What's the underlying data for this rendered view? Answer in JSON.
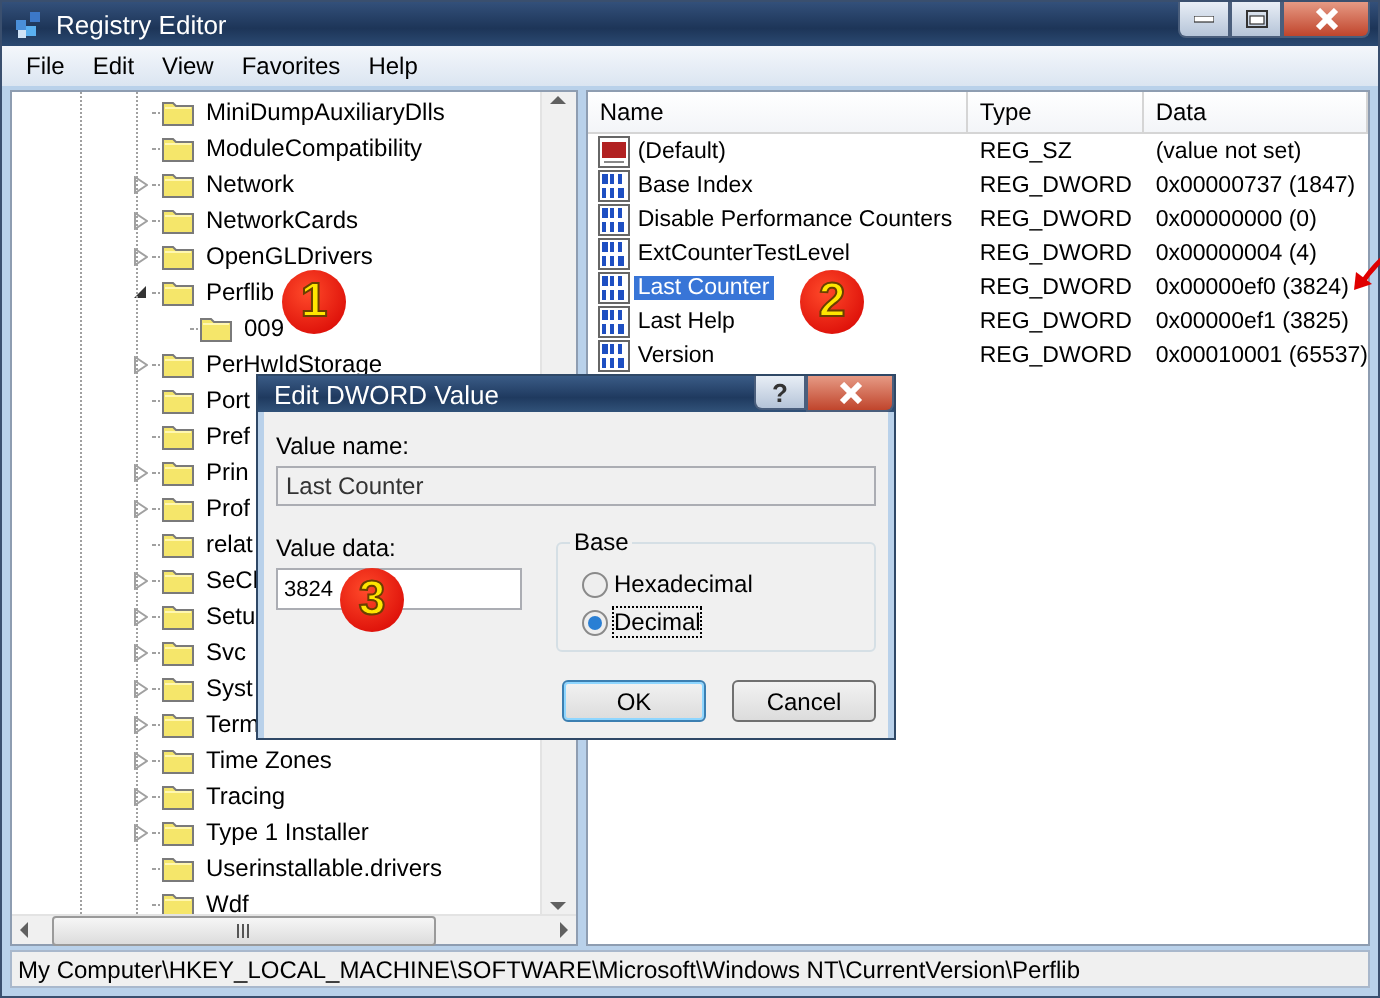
{
  "window": {
    "title": "Registry Editor"
  },
  "menu": [
    "File",
    "Edit",
    "View",
    "Favorites",
    "Help"
  ],
  "tree": {
    "items": [
      {
        "label": "MiniDumpAuxiliaryDlls",
        "expandable": false,
        "selected": false
      },
      {
        "label": "ModuleCompatibility",
        "expandable": false,
        "selected": false
      },
      {
        "label": "Network",
        "expandable": true,
        "expanded": false,
        "selected": false
      },
      {
        "label": "NetworkCards",
        "expandable": true,
        "expanded": false,
        "selected": false
      },
      {
        "label": "OpenGLDrivers",
        "expandable": true,
        "expanded": false,
        "selected": false
      },
      {
        "label": "Perflib",
        "expandable": true,
        "expanded": true,
        "selected": false,
        "children": [
          {
            "label": "009",
            "expandable": false,
            "selected": false
          }
        ]
      },
      {
        "label": "PerHwIdStorage",
        "expandable": true,
        "expanded": false,
        "selected": false
      },
      {
        "label": "Port",
        "expandable": false,
        "selected": false
      },
      {
        "label": "Pref",
        "expandable": false,
        "selected": false
      },
      {
        "label": "Prin",
        "expandable": true,
        "expanded": false,
        "selected": false
      },
      {
        "label": "Prof",
        "expandable": true,
        "expanded": false,
        "selected": false
      },
      {
        "label": "relat",
        "expandable": false,
        "selected": false
      },
      {
        "label": "SeCl",
        "expandable": true,
        "expanded": false,
        "selected": false
      },
      {
        "label": "Setu",
        "expandable": true,
        "expanded": false,
        "selected": false
      },
      {
        "label": "Svc",
        "expandable": true,
        "expanded": false,
        "selected": false
      },
      {
        "label": "Syst",
        "expandable": true,
        "expanded": false,
        "selected": false
      },
      {
        "label": "Term",
        "expandable": true,
        "expanded": false,
        "selected": false
      },
      {
        "label": "Time Zones",
        "expandable": true,
        "expanded": false,
        "selected": false
      },
      {
        "label": "Tracing",
        "expandable": true,
        "expanded": false,
        "selected": false
      },
      {
        "label": "Type 1 Installer",
        "expandable": true,
        "expanded": false,
        "selected": false
      },
      {
        "label": "Userinstallable.drivers",
        "expandable": false,
        "selected": false
      },
      {
        "label": "Wdf",
        "expandable": false,
        "selected": false
      }
    ]
  },
  "values": {
    "columns": [
      "Name",
      "Type",
      "Data"
    ],
    "rows": [
      {
        "kind": "string",
        "name": "(Default)",
        "type": "REG_SZ",
        "data": "(value not set)",
        "selected": false
      },
      {
        "kind": "dword",
        "name": "Base Index",
        "type": "REG_DWORD",
        "data": "0x00000737 (1847)",
        "selected": false
      },
      {
        "kind": "dword",
        "name": "Disable Performance Counters",
        "type": "REG_DWORD",
        "data": "0x00000000 (0)",
        "selected": false
      },
      {
        "kind": "dword",
        "name": "ExtCounterTestLevel",
        "type": "REG_DWORD",
        "data": "0x00000004 (4)",
        "selected": false
      },
      {
        "kind": "dword",
        "name": "Last Counter",
        "type": "REG_DWORD",
        "data": "0x00000ef0 (3824)",
        "selected": true
      },
      {
        "kind": "dword",
        "name": "Last Help",
        "type": "REG_DWORD",
        "data": "0x00000ef1 (3825)",
        "selected": false
      },
      {
        "kind": "dword",
        "name": "Version",
        "type": "REG_DWORD",
        "data": "0x00010001 (65537)",
        "selected": false
      }
    ]
  },
  "dialog": {
    "title": "Edit DWORD Value",
    "help": "?",
    "value_name_label": "Value name:",
    "value_name": "Last Counter",
    "value_data_label": "Value data:",
    "value_data": "3824",
    "base_label": "Base",
    "bases": [
      {
        "label": "Hexadecimal",
        "selected": false
      },
      {
        "label": "Decimal",
        "selected": true
      }
    ],
    "buttons": [
      {
        "label": "OK",
        "default": true
      },
      {
        "label": "Cancel",
        "default": false
      }
    ]
  },
  "annotations": [
    {
      "kind": "badge",
      "text": "1"
    },
    {
      "kind": "badge",
      "text": "2"
    },
    {
      "kind": "badge",
      "text": "3"
    },
    {
      "kind": "arrow"
    }
  ],
  "status_bar": "My Computer\\HKEY_LOCAL_MACHINE\\SOFTWARE\\Microsoft\\Windows NT\\CurrentVersion\\Perflib"
}
